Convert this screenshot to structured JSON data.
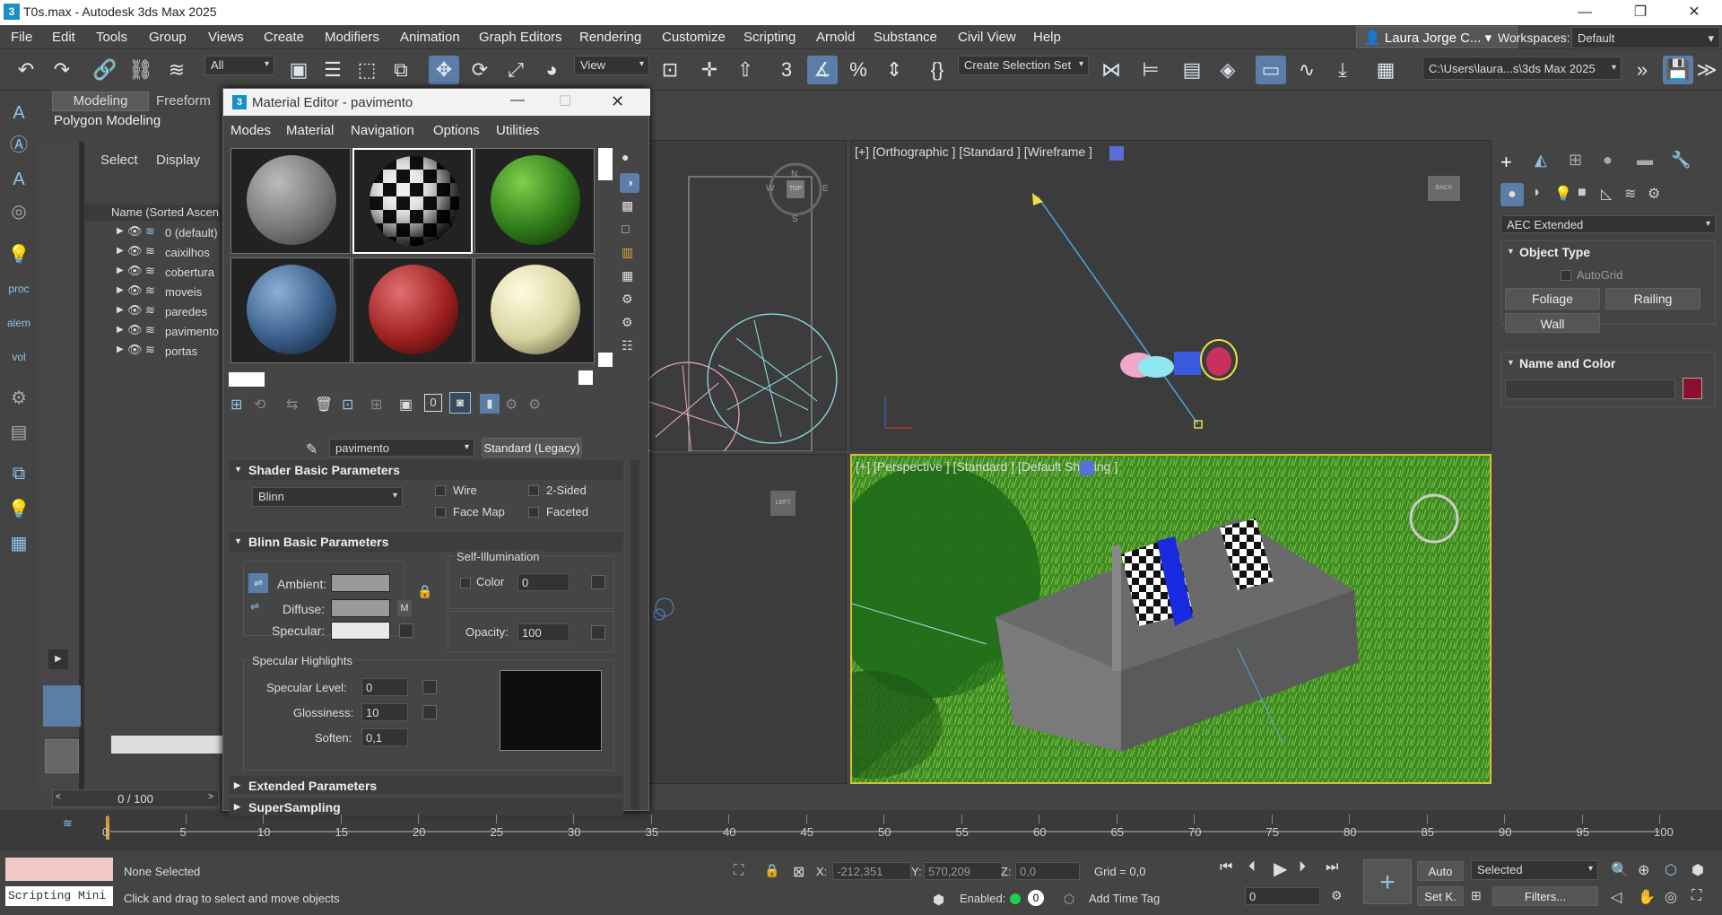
{
  "app": {
    "title": "T0s.max - Autodesk 3ds Max 2025",
    "logo": "3"
  },
  "menus": [
    "File",
    "Edit",
    "Tools",
    "Group",
    "Views",
    "Create",
    "Modifiers",
    "Animation",
    "Graph Editors",
    "Rendering",
    "Customize",
    "Scripting",
    "Arnold",
    "Substance",
    "Civil View",
    "Help"
  ],
  "user": {
    "name": "Laura Jorge C...",
    "workspaces_label": "Workspaces:",
    "workspace": "Default"
  },
  "toolbar": {
    "filter": "All",
    "refcoord": "View",
    "selection_set": "Create Selection Set",
    "path": "C:\\Users\\laura...s\\3ds Max 2025",
    "angle_snap": "3"
  },
  "ribbon": {
    "tabs": [
      "Modeling",
      "Freeform"
    ],
    "sub": "Polygon Modeling"
  },
  "explorer": {
    "tabs": [
      "Select",
      "Display"
    ],
    "header": "Name (Sorted Ascen",
    "layers": [
      "0 (default)",
      "caixilhos",
      "cobertura",
      "moveis",
      "paredes",
      "pavimento",
      "portas"
    ]
  },
  "viewports": {
    "top_right": "[+] [Orthographic ] [Standard ] [Wireframe ]",
    "bottom_right": "[+] [Perspective ] [Standard ] [Default Shading ]",
    "cube_back": "BACK",
    "cube_left": "LEFT",
    "cube_top": "TOP",
    "compass": {
      "n": "N",
      "s": "S",
      "e": "E",
      "w": "W"
    }
  },
  "material_editor": {
    "title": "Material Editor - pavimento",
    "menus": [
      "Modes",
      "Material",
      "Navigation",
      "Options",
      "Utilities"
    ],
    "material_name": "pavimento",
    "material_type": "Standard (Legacy)",
    "zero_btn": "0",
    "shader": {
      "header": "Shader Basic Parameters",
      "type": "Blinn",
      "wire": "Wire",
      "two_sided": "2-Sided",
      "face_map": "Face Map",
      "faceted": "Faceted"
    },
    "blinn": {
      "header": "Blinn Basic Parameters",
      "ambient": "Ambient:",
      "diffuse": "Diffuse:",
      "specular": "Specular:",
      "m": "M",
      "self_illum": "Self-Illumination",
      "color": "Color",
      "color_val": "0",
      "opacity": "Opacity:",
      "opacity_val": "100"
    },
    "spec": {
      "header": "Specular Highlights",
      "level": "Specular Level:",
      "level_val": "0",
      "gloss": "Glossiness:",
      "gloss_val": "10",
      "soften": "Soften:",
      "soften_val": "0,1"
    },
    "extended": "Extended Parameters",
    "supersampling": "SuperSampling"
  },
  "command_panel": {
    "category": "AEC Extended",
    "object_type": "Object Type",
    "autogrid": "AutoGrid",
    "buttons": [
      "Foliage",
      "Railing",
      "Wall"
    ],
    "name_color": "Name and Color",
    "color": "#8b1030"
  },
  "timeline": {
    "frame": "0 / 100",
    "ticks": [
      "0",
      "5",
      "10",
      "15",
      "20",
      "25",
      "30",
      "35",
      "40",
      "45",
      "50",
      "55",
      "60",
      "65",
      "70",
      "75",
      "80",
      "85",
      "90",
      "95",
      "100"
    ]
  },
  "status": {
    "script": "Scripting Mini",
    "none_selected": "None Selected",
    "hint": "Click and drag to select and move objects",
    "x_label": "X:",
    "x": "-212,351",
    "y_label": "Y:",
    "y": "570,209",
    "z_label": "Z:",
    "z": "0,0",
    "grid": "Grid = 0,0",
    "enabled": "Enabled:",
    "enabled_val": "0",
    "add_time_tag": "Add Time Tag",
    "auto": "Auto",
    "setk": "Set K.",
    "selected": "Selected",
    "filters": "Filters...",
    "frame": "0"
  }
}
